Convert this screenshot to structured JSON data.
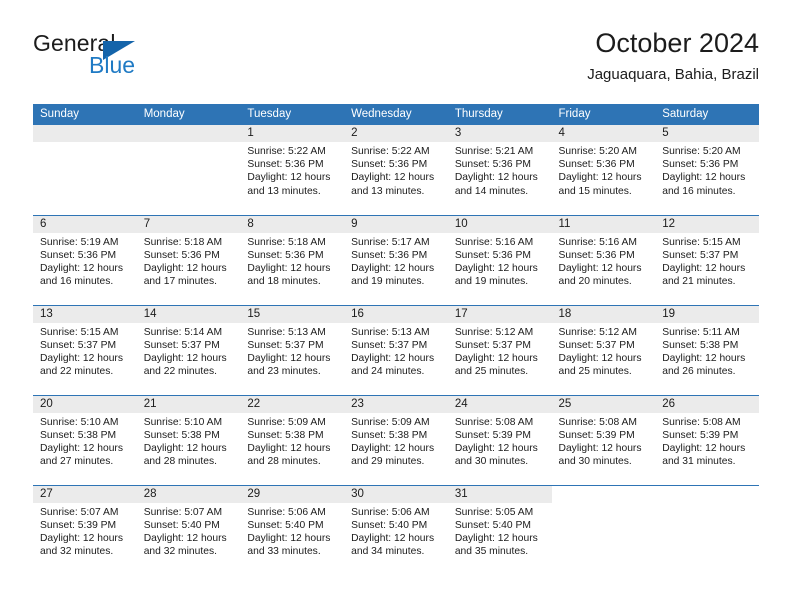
{
  "brand": {
    "line1": "General",
    "line2": "Blue",
    "triangle_color": "#1464aa",
    "line2_color": "#1f7ac4"
  },
  "header": {
    "title": "October 2024",
    "subtitle": "Jaguaquara, Bahia, Brazil"
  },
  "theme": {
    "header_row_bg": "#2e74b5",
    "header_row_text": "#ffffff",
    "daynum_band_bg": "#ebebeb",
    "row_divider": "#2e74b5",
    "body_text": "#1c1c1c"
  },
  "calendar": {
    "weekday_headers": [
      "Sunday",
      "Monday",
      "Tuesday",
      "Wednesday",
      "Thursday",
      "Friday",
      "Saturday"
    ],
    "weeks": [
      [
        {
          "day": "",
          "empty": true
        },
        {
          "day": "",
          "empty": true
        },
        {
          "day": "1",
          "sunrise": "Sunrise: 5:22 AM",
          "sunset": "Sunset: 5:36 PM",
          "daylight1": "Daylight: 12 hours",
          "daylight2": "and 13 minutes."
        },
        {
          "day": "2",
          "sunrise": "Sunrise: 5:22 AM",
          "sunset": "Sunset: 5:36 PM",
          "daylight1": "Daylight: 12 hours",
          "daylight2": "and 13 minutes."
        },
        {
          "day": "3",
          "sunrise": "Sunrise: 5:21 AM",
          "sunset": "Sunset: 5:36 PM",
          "daylight1": "Daylight: 12 hours",
          "daylight2": "and 14 minutes."
        },
        {
          "day": "4",
          "sunrise": "Sunrise: 5:20 AM",
          "sunset": "Sunset: 5:36 PM",
          "daylight1": "Daylight: 12 hours",
          "daylight2": "and 15 minutes."
        },
        {
          "day": "5",
          "sunrise": "Sunrise: 5:20 AM",
          "sunset": "Sunset: 5:36 PM",
          "daylight1": "Daylight: 12 hours",
          "daylight2": "and 16 minutes."
        }
      ],
      [
        {
          "day": "6",
          "sunrise": "Sunrise: 5:19 AM",
          "sunset": "Sunset: 5:36 PM",
          "daylight1": "Daylight: 12 hours",
          "daylight2": "and 16 minutes."
        },
        {
          "day": "7",
          "sunrise": "Sunrise: 5:18 AM",
          "sunset": "Sunset: 5:36 PM",
          "daylight1": "Daylight: 12 hours",
          "daylight2": "and 17 minutes."
        },
        {
          "day": "8",
          "sunrise": "Sunrise: 5:18 AM",
          "sunset": "Sunset: 5:36 PM",
          "daylight1": "Daylight: 12 hours",
          "daylight2": "and 18 minutes."
        },
        {
          "day": "9",
          "sunrise": "Sunrise: 5:17 AM",
          "sunset": "Sunset: 5:36 PM",
          "daylight1": "Daylight: 12 hours",
          "daylight2": "and 19 minutes."
        },
        {
          "day": "10",
          "sunrise": "Sunrise: 5:16 AM",
          "sunset": "Sunset: 5:36 PM",
          "daylight1": "Daylight: 12 hours",
          "daylight2": "and 19 minutes."
        },
        {
          "day": "11",
          "sunrise": "Sunrise: 5:16 AM",
          "sunset": "Sunset: 5:36 PM",
          "daylight1": "Daylight: 12 hours",
          "daylight2": "and 20 minutes."
        },
        {
          "day": "12",
          "sunrise": "Sunrise: 5:15 AM",
          "sunset": "Sunset: 5:37 PM",
          "daylight1": "Daylight: 12 hours",
          "daylight2": "and 21 minutes."
        }
      ],
      [
        {
          "day": "13",
          "sunrise": "Sunrise: 5:15 AM",
          "sunset": "Sunset: 5:37 PM",
          "daylight1": "Daylight: 12 hours",
          "daylight2": "and 22 minutes."
        },
        {
          "day": "14",
          "sunrise": "Sunrise: 5:14 AM",
          "sunset": "Sunset: 5:37 PM",
          "daylight1": "Daylight: 12 hours",
          "daylight2": "and 22 minutes."
        },
        {
          "day": "15",
          "sunrise": "Sunrise: 5:13 AM",
          "sunset": "Sunset: 5:37 PM",
          "daylight1": "Daylight: 12 hours",
          "daylight2": "and 23 minutes."
        },
        {
          "day": "16",
          "sunrise": "Sunrise: 5:13 AM",
          "sunset": "Sunset: 5:37 PM",
          "daylight1": "Daylight: 12 hours",
          "daylight2": "and 24 minutes."
        },
        {
          "day": "17",
          "sunrise": "Sunrise: 5:12 AM",
          "sunset": "Sunset: 5:37 PM",
          "daylight1": "Daylight: 12 hours",
          "daylight2": "and 25 minutes."
        },
        {
          "day": "18",
          "sunrise": "Sunrise: 5:12 AM",
          "sunset": "Sunset: 5:37 PM",
          "daylight1": "Daylight: 12 hours",
          "daylight2": "and 25 minutes."
        },
        {
          "day": "19",
          "sunrise": "Sunrise: 5:11 AM",
          "sunset": "Sunset: 5:38 PM",
          "daylight1": "Daylight: 12 hours",
          "daylight2": "and 26 minutes."
        }
      ],
      [
        {
          "day": "20",
          "sunrise": "Sunrise: 5:10 AM",
          "sunset": "Sunset: 5:38 PM",
          "daylight1": "Daylight: 12 hours",
          "daylight2": "and 27 minutes."
        },
        {
          "day": "21",
          "sunrise": "Sunrise: 5:10 AM",
          "sunset": "Sunset: 5:38 PM",
          "daylight1": "Daylight: 12 hours",
          "daylight2": "and 28 minutes."
        },
        {
          "day": "22",
          "sunrise": "Sunrise: 5:09 AM",
          "sunset": "Sunset: 5:38 PM",
          "daylight1": "Daylight: 12 hours",
          "daylight2": "and 28 minutes."
        },
        {
          "day": "23",
          "sunrise": "Sunrise: 5:09 AM",
          "sunset": "Sunset: 5:38 PM",
          "daylight1": "Daylight: 12 hours",
          "daylight2": "and 29 minutes."
        },
        {
          "day": "24",
          "sunrise": "Sunrise: 5:08 AM",
          "sunset": "Sunset: 5:39 PM",
          "daylight1": "Daylight: 12 hours",
          "daylight2": "and 30 minutes."
        },
        {
          "day": "25",
          "sunrise": "Sunrise: 5:08 AM",
          "sunset": "Sunset: 5:39 PM",
          "daylight1": "Daylight: 12 hours",
          "daylight2": "and 30 minutes."
        },
        {
          "day": "26",
          "sunrise": "Sunrise: 5:08 AM",
          "sunset": "Sunset: 5:39 PM",
          "daylight1": "Daylight: 12 hours",
          "daylight2": "and 31 minutes."
        }
      ],
      [
        {
          "day": "27",
          "sunrise": "Sunrise: 5:07 AM",
          "sunset": "Sunset: 5:39 PM",
          "daylight1": "Daylight: 12 hours",
          "daylight2": "and 32 minutes."
        },
        {
          "day": "28",
          "sunrise": "Sunrise: 5:07 AM",
          "sunset": "Sunset: 5:40 PM",
          "daylight1": "Daylight: 12 hours",
          "daylight2": "and 32 minutes."
        },
        {
          "day": "29",
          "sunrise": "Sunrise: 5:06 AM",
          "sunset": "Sunset: 5:40 PM",
          "daylight1": "Daylight: 12 hours",
          "daylight2": "and 33 minutes."
        },
        {
          "day": "30",
          "sunrise": "Sunrise: 5:06 AM",
          "sunset": "Sunset: 5:40 PM",
          "daylight1": "Daylight: 12 hours",
          "daylight2": "and 34 minutes."
        },
        {
          "day": "31",
          "sunrise": "Sunrise: 5:05 AM",
          "sunset": "Sunset: 5:40 PM",
          "daylight1": "Daylight: 12 hours",
          "daylight2": "and 35 minutes."
        },
        {
          "day": "",
          "empty": true,
          "blank": true
        },
        {
          "day": "",
          "empty": true,
          "blank": true
        }
      ]
    ]
  }
}
